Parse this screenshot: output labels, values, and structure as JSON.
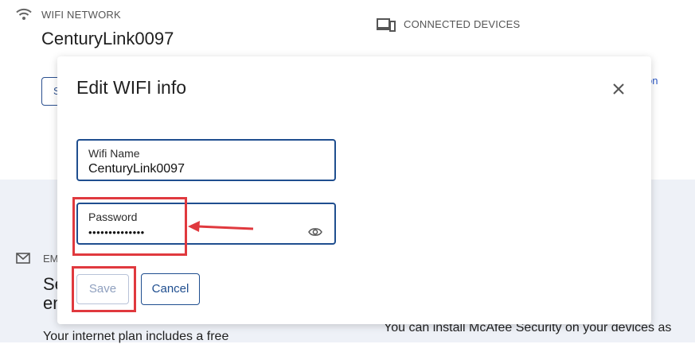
{
  "background": {
    "wifi_section_label": "WIFI NETWORK",
    "wifi_network_name": "CenturyLink0097",
    "devices_section_label": "CONNECTED DEVICES",
    "button_fragment": "S",
    "link_fragment": "on",
    "email_fragment": "EM",
    "heading_fragment": "Se en",
    "plan_text": "Your internet plan includes a free",
    "mcafee_text": "You can install McAfee Security on your devices as"
  },
  "modal": {
    "title": "Edit WIFI info",
    "wifi_name_label": "Wifi Name",
    "wifi_name_value": "CenturyLink0097",
    "password_label": "Password",
    "password_value": "••••••••••••••",
    "save_label": "Save",
    "cancel_label": "Cancel"
  },
  "icons": {
    "wifi": "wifi-icon",
    "devices": "devices-icon",
    "mail": "mail-icon",
    "close": "close-icon",
    "eye": "eye-icon"
  },
  "colors": {
    "accent": "#1f4e8f",
    "annotation": "#e0393e",
    "disabled_text": "#8fa0bf",
    "lower_background": "#eef1f7"
  }
}
